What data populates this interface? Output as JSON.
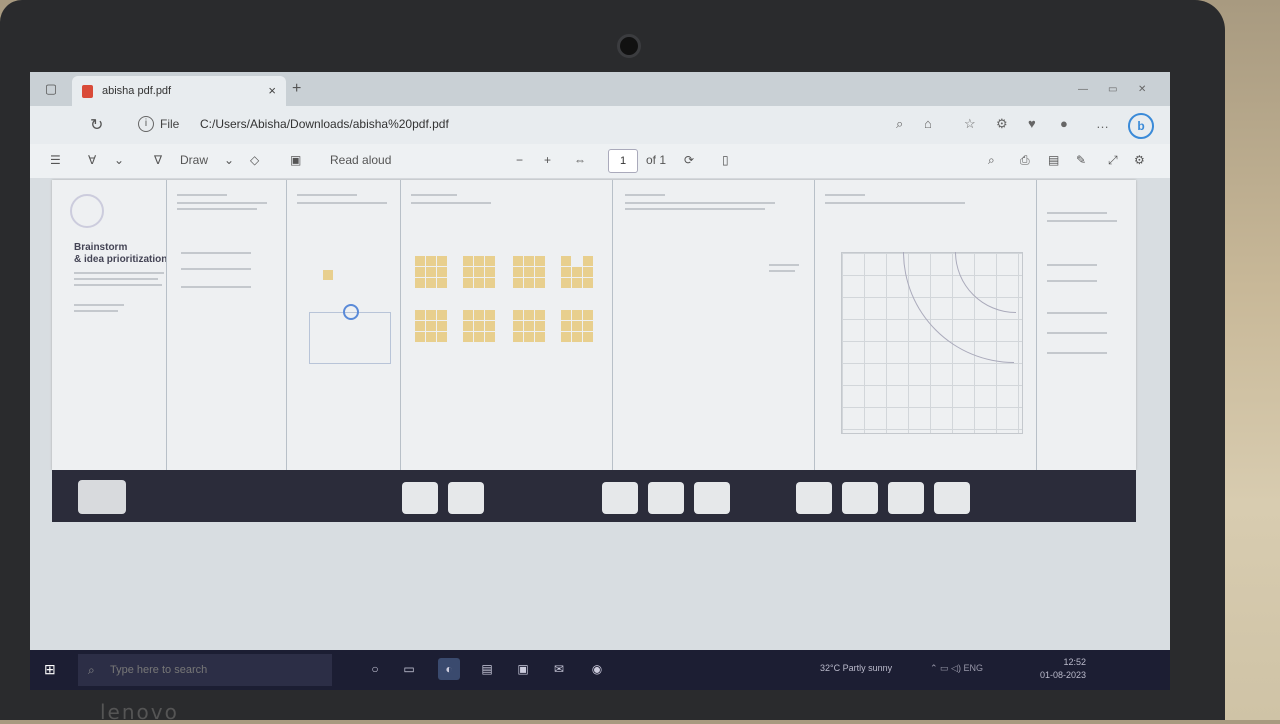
{
  "browser": {
    "tab_title": "abisha pdf.pdf",
    "close_glyph": "×",
    "new_tab_glyph": "+",
    "address_label": "File",
    "url": "C:/Users/Abisha/Downloads/abisha%20pdf.pdf"
  },
  "pdf_toolbar": {
    "draw_label": "Draw",
    "read_aloud_label": "Read aloud",
    "page_number": "1",
    "page_of": "of 1",
    "minus": "−",
    "plus": "+"
  },
  "document": {
    "hero_title_line1": "Brainstorm",
    "hero_title_line2": "& idea prioritization"
  },
  "taskbar": {
    "search_placeholder": "Type here to search",
    "weather": "32°C  Partly sunny",
    "time": "12:52",
    "date": "01-08-2023"
  },
  "brand": {
    "text": "lenovo"
  },
  "colors": {
    "sticky_note": "#e8cf8e",
    "taskbar": "#1c1e33",
    "pdf_icon": "#d94a38",
    "bing_accent": "#3a8ad8"
  }
}
